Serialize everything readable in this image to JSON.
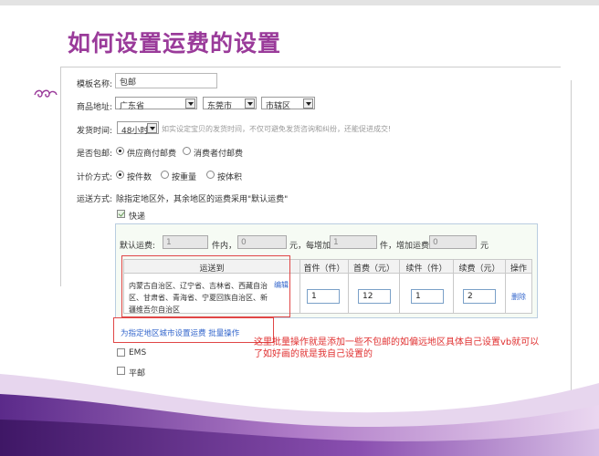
{
  "title": "如何设置运费的设置",
  "form": {
    "template_name_label": "模板名称:",
    "template_name_value": "包邮",
    "address_label": "商品地址:",
    "province": "广东省",
    "city": "东莞市",
    "district": "市辖区",
    "ship_time_label": "发货时间:",
    "ship_time_value": "48小时",
    "ship_time_hint": "如实设定宝贝的发货时间，不仅可避免发货咨询和纠纷，还能促进成交!",
    "free_ship_label": "是否包邮:",
    "free_ship_options": [
      "供应商付邮费",
      "消费者付邮费"
    ],
    "pricing_label": "计价方式:",
    "pricing_options": [
      "按件数",
      "按重量",
      "按体积"
    ],
    "shipping_label": "运送方式:",
    "shipping_hint": "除指定地区外，其余地区的运费采用\"默认运费\""
  },
  "express": {
    "label": "快递",
    "checked": true,
    "default_label": "默认运费:",
    "first_value": "1",
    "unit_a": "件内，",
    "first_fee": "0",
    "unit_b": "元，每增加",
    "add_value": "1",
    "unit_c": "件，增加运费",
    "add_fee": "0",
    "unit_d": "元",
    "table": {
      "headers": [
        "运送到",
        "首件（件）",
        "首费（元）",
        "续件（件）",
        "续费（元）",
        "操作"
      ],
      "row": {
        "regions": "内蒙古自治区、辽宁省、吉林省、西藏自治区、甘肃省、青海省、宁夏回族自治区、新疆维吾尔自治区",
        "edit": "编辑",
        "first_item": "1",
        "first_fee": "12",
        "extra_item": "1",
        "extra_fee": "2",
        "delete": "删除"
      }
    },
    "batch_link": "为指定地区城市设置运费 批量操作"
  },
  "other_methods": [
    {
      "label": "EMS",
      "checked": false
    },
    {
      "label": "平邮",
      "checked": false
    }
  ],
  "annotation": "这里批量操作就是添加一些不包邮的如偏远地区具体自己设置vb就可以了如好画的就是我自己设置的",
  "colors": {
    "title": "#9a3b9a",
    "annotation": "#e03030",
    "link": "#3366cc"
  }
}
